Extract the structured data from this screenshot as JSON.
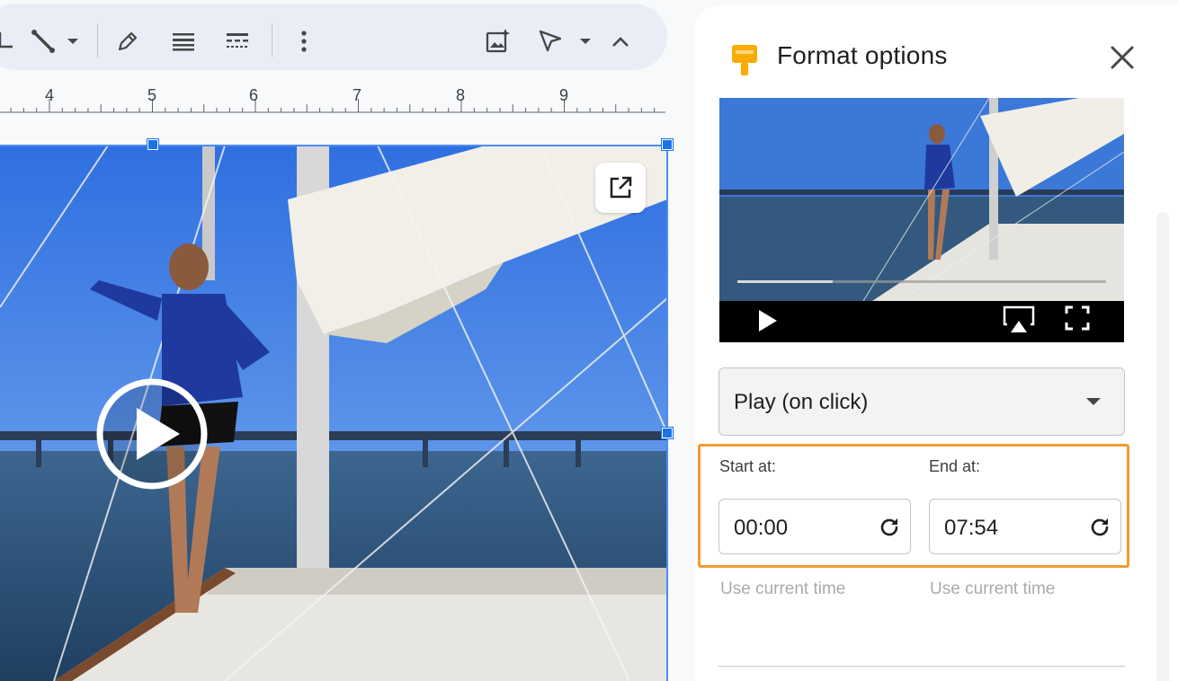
{
  "panel": {
    "title": "Format options",
    "playback_mode": "Play (on click)",
    "start_label": "Start at:",
    "end_label": "End at:",
    "start_time": "00:00",
    "end_time": "07:54",
    "use_current_time": "Use current time"
  },
  "ruler": {
    "numbers": [
      "4",
      "5",
      "6",
      "7",
      "8",
      "9"
    ]
  },
  "colors": {
    "accent": "#f29b2f",
    "selection": "#1a73e8",
    "panel_icon": "#f9ab00"
  },
  "icons": {
    "toolbar": [
      "crop-icon",
      "line-icon",
      "dropdown-arrow-icon",
      "pen-icon",
      "border-weight-icon",
      "border-dash-icon",
      "more-vert-icon",
      "image-sparkle-icon",
      "select-pointer-icon",
      "dropdown-arrow-icon",
      "collapse-chevron-icon"
    ]
  }
}
